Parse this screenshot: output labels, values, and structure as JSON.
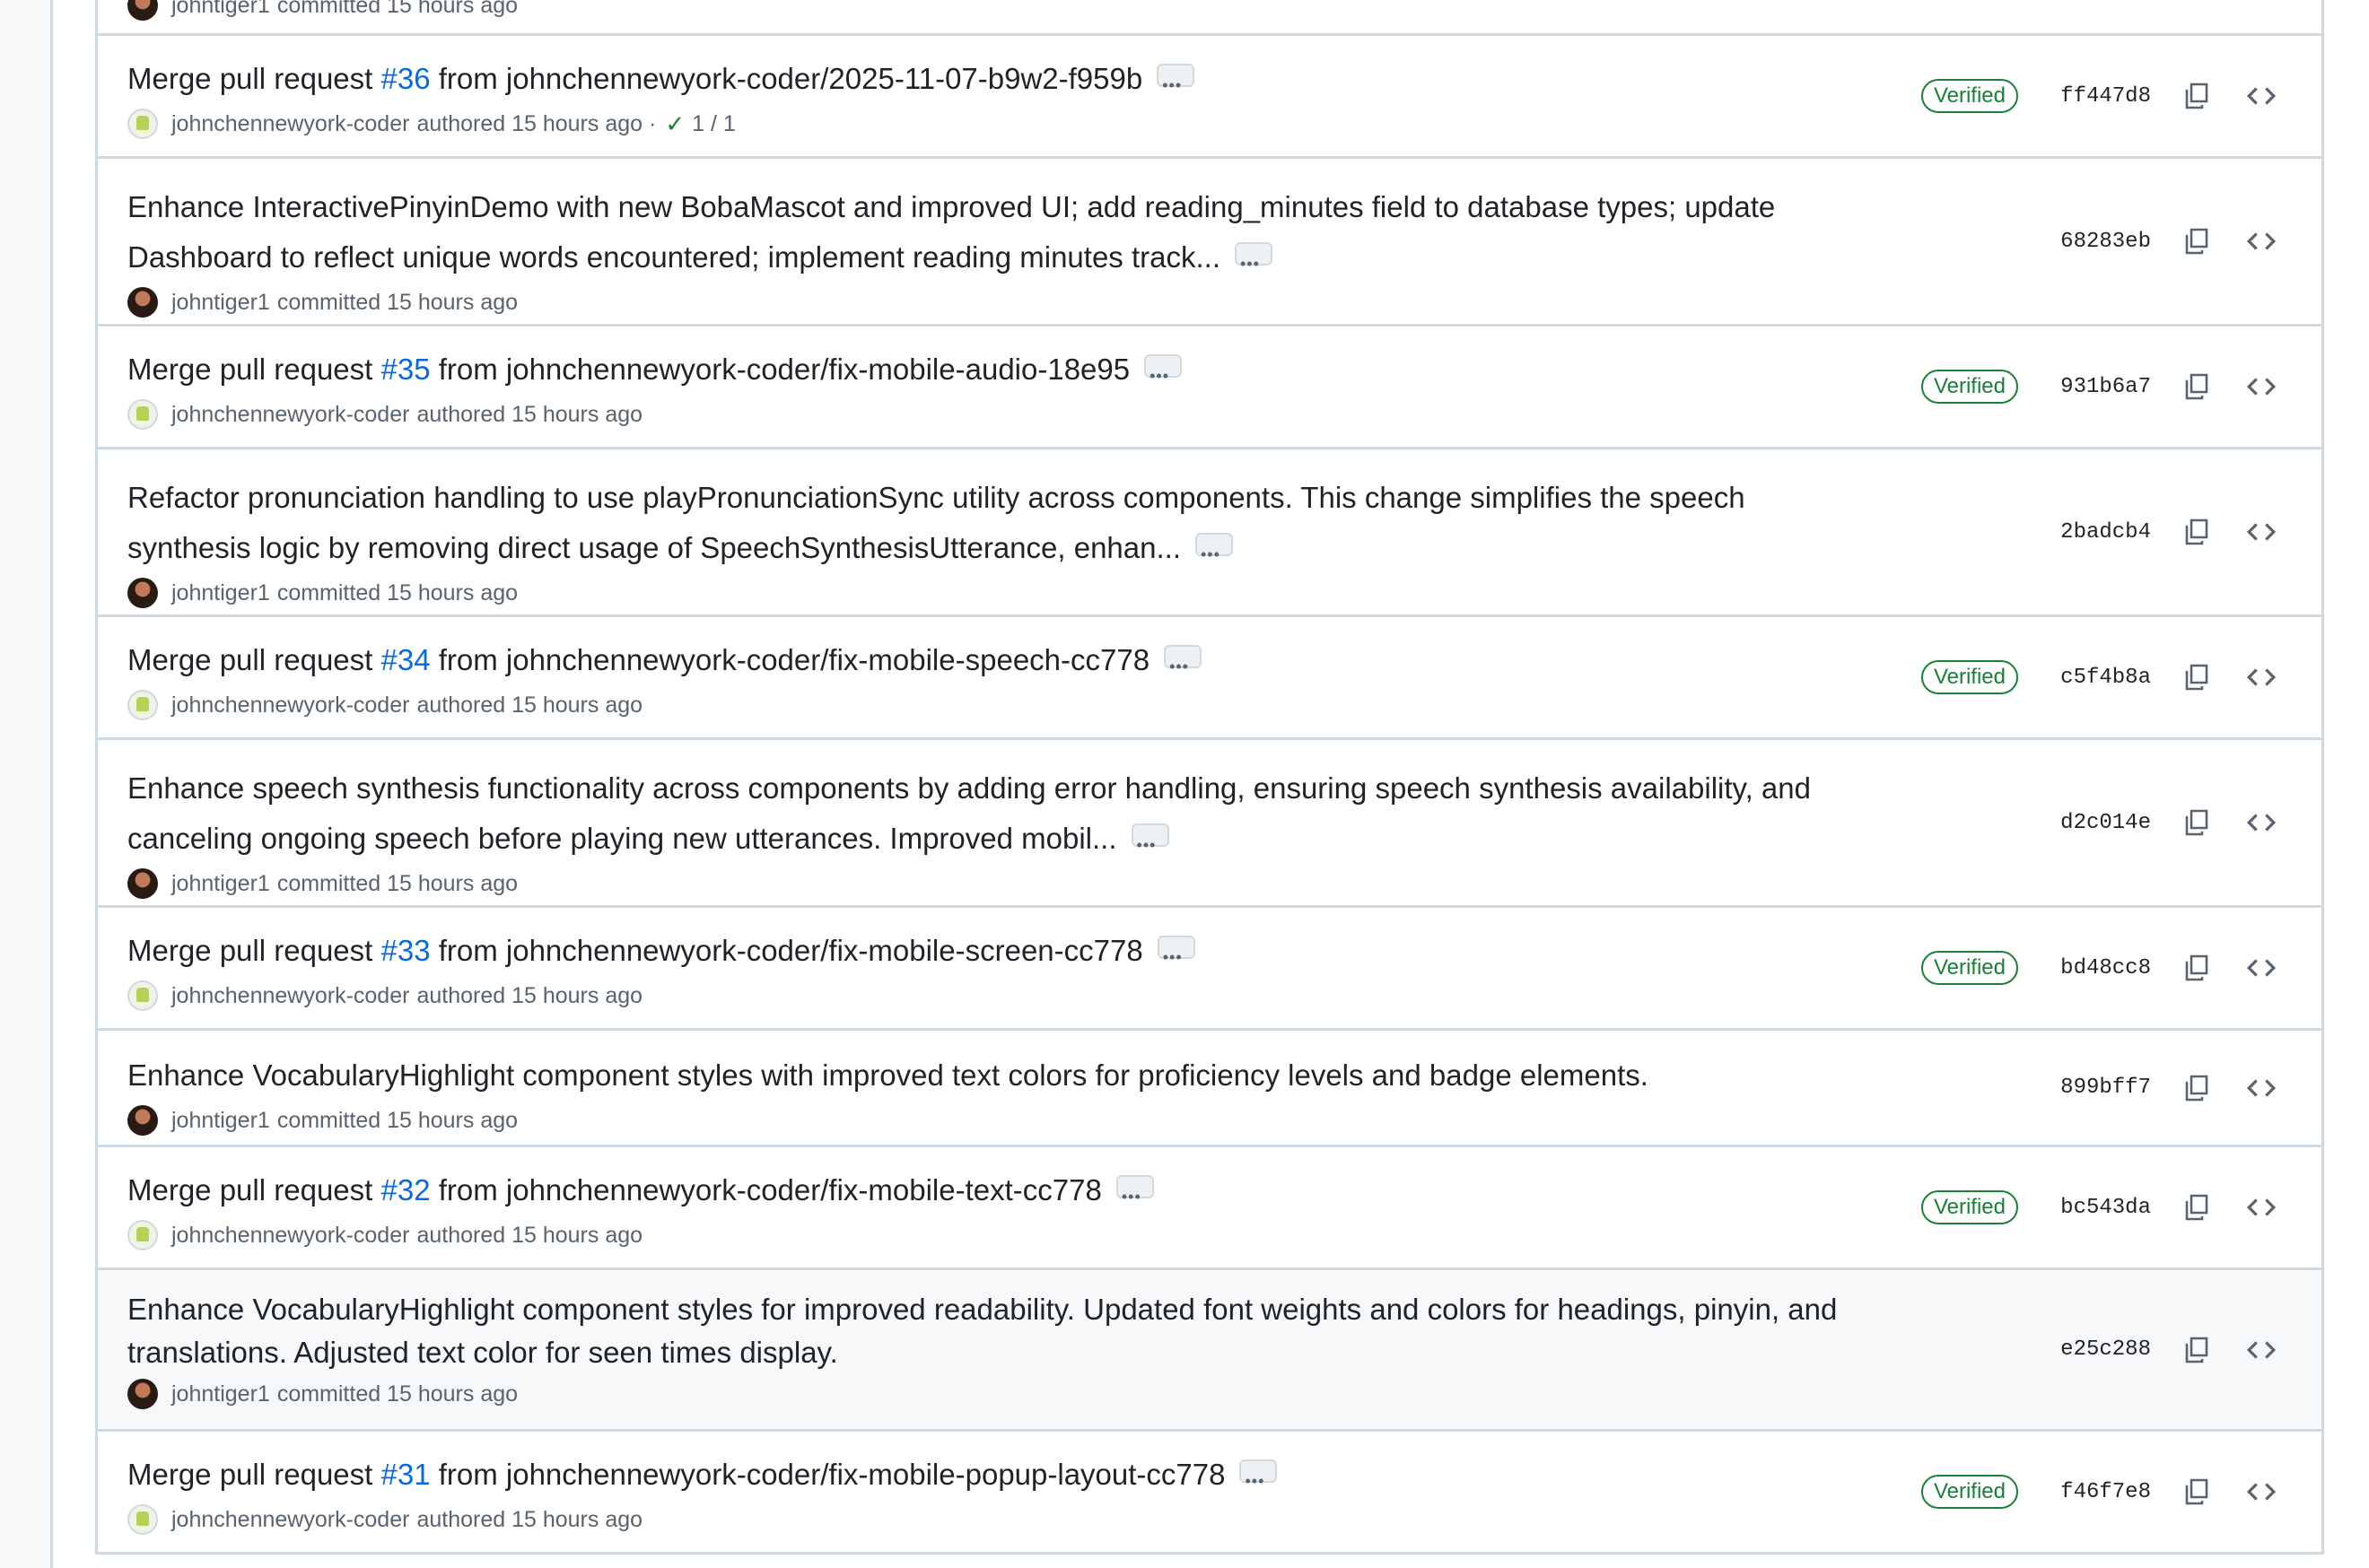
{
  "commits": [
    {
      "kind": "partial",
      "author": "johntiger1",
      "action": "committed",
      "time": "15 hours ago"
    },
    {
      "kind": "pr",
      "prefix": "Merge pull request ",
      "pr": "#36",
      "suffix": " from johnchennewyork-coder/2025-11-07-b9w2-f959b",
      "author": "johnchennewyork-coder",
      "action": "authored",
      "time": "15 hours ago",
      "checks": "1 / 1",
      "verified": "Verified",
      "sha": "ff447d8"
    },
    {
      "kind": "commit",
      "title": "Enhance InteractivePinyinDemo with new BobaMascot and improved UI; add reading_minutes field to database types; update Dashboard to reflect unique words encountered; implement reading minutes track...",
      "author": "johntiger1",
      "action": "committed",
      "time": "15 hours ago",
      "sha": "68283eb"
    },
    {
      "kind": "pr",
      "prefix": "Merge pull request ",
      "pr": "#35",
      "suffix": " from johnchennewyork-coder/fix-mobile-audio-18e95",
      "author": "johnchennewyork-coder",
      "action": "authored",
      "time": "15 hours ago",
      "verified": "Verified",
      "sha": "931b6a7"
    },
    {
      "kind": "commit",
      "title": "Refactor pronunciation handling to use playPronunciationSync utility across components. This change simplifies the speech synthesis logic by removing direct usage of SpeechSynthesisUtterance, enhan...",
      "author": "johntiger1",
      "action": "committed",
      "time": "15 hours ago",
      "sha": "2badcb4"
    },
    {
      "kind": "pr",
      "prefix": "Merge pull request ",
      "pr": "#34",
      "suffix": " from johnchennewyork-coder/fix-mobile-speech-cc778",
      "author": "johnchennewyork-coder",
      "action": "authored",
      "time": "15 hours ago",
      "verified": "Verified",
      "sha": "c5f4b8a"
    },
    {
      "kind": "commit",
      "title": "Enhance speech synthesis functionality across components by adding error handling, ensuring speech synthesis availability, and canceling ongoing speech before playing new utterances. Improved mobil...",
      "author": "johntiger1",
      "action": "committed",
      "time": "15 hours ago",
      "sha": "d2c014e"
    },
    {
      "kind": "pr",
      "prefix": "Merge pull request ",
      "pr": "#33",
      "suffix": " from johnchennewyork-coder/fix-mobile-screen-cc778",
      "author": "johnchennewyork-coder",
      "action": "authored",
      "time": "15 hours ago",
      "verified": "Verified",
      "sha": "bd48cc8"
    },
    {
      "kind": "commit",
      "title": "Enhance VocabularyHighlight component styles with improved text colors for proficiency levels and badge elements.",
      "author": "johntiger1",
      "action": "committed",
      "time": "15 hours ago",
      "sha": "899bff7"
    },
    {
      "kind": "pr",
      "prefix": "Merge pull request ",
      "pr": "#32",
      "suffix": " from johnchennewyork-coder/fix-mobile-text-cc778",
      "author": "johnchennewyork-coder",
      "action": "authored",
      "time": "15 hours ago",
      "verified": "Verified",
      "sha": "bc543da"
    },
    {
      "kind": "commit",
      "title": "Enhance VocabularyHighlight component styles for improved readability. Updated font weights and colors for headings, pinyin, and translations. Adjusted text color for seen times display.",
      "author": "johntiger1",
      "action": "committed",
      "time": "15 hours ago",
      "sha": "e25c288"
    },
    {
      "kind": "pr",
      "prefix": "Merge pull request ",
      "pr": "#31",
      "suffix": " from johnchennewyork-coder/fix-mobile-popup-layout-cc778",
      "author": "johnchennewyork-coder",
      "action": "authored",
      "time": "15 hours ago",
      "verified": "Verified",
      "sha": "f46f7e8"
    }
  ],
  "colors": {
    "link": "#0969da",
    "verified": "#1a7f37",
    "muted": "#59636e",
    "border": "#d1d9e0"
  },
  "icons": {
    "copy": "copy-icon",
    "browse": "code-icon",
    "more": "ellipsis-icon",
    "check": "check-icon"
  }
}
